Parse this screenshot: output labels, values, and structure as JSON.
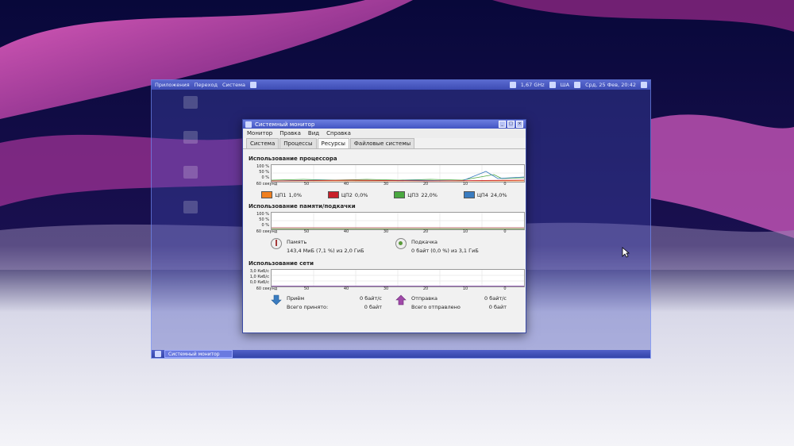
{
  "colors": {
    "panel": "#4355c2",
    "accent": "#ff7a1a"
  },
  "top_panel": {
    "menus": [
      "Приложения",
      "Переход",
      "Система"
    ],
    "cpu_freq": "1,67 GHz",
    "keyboard": "ША",
    "clock": "Срд, 25 Фев, 20:42"
  },
  "window": {
    "title": "Системный монитор",
    "menu": [
      "Монитор",
      "Правка",
      "Вид",
      "Справка"
    ],
    "tabs": [
      "Система",
      "Процессы",
      "Ресурсы",
      "Файловые системы"
    ],
    "active_tab": 2,
    "cpu": {
      "title": "Использование процессора",
      "y_labels": [
        "100 %",
        "50 %",
        "0 %"
      ],
      "x_labels": [
        "60 секунд",
        "50",
        "40",
        "30",
        "20",
        "10",
        "0"
      ],
      "legend": [
        {
          "label": "ЦП1",
          "value": "1,0%",
          "color": "#f08020"
        },
        {
          "label": "ЦП2",
          "value": "0,0%",
          "color": "#c8202a"
        },
        {
          "label": "ЦП3",
          "value": "22,0%",
          "color": "#4aa840"
        },
        {
          "label": "ЦП4",
          "value": "24,0%",
          "color": "#3a7cc0"
        }
      ]
    },
    "memory": {
      "title": "Использование памяти/подкачки",
      "y_labels": [
        "100 %",
        "50 %",
        "0 %"
      ],
      "x_labels": [
        "60 секунд",
        "50",
        "40",
        "30",
        "20",
        "10",
        "0"
      ],
      "mem_label": "Память",
      "mem_value": "143,4 МиБ (7,1 %) из 2,0 ГиБ",
      "swap_label": "Подкачка",
      "swap_value": "0 байт (0,0 %) из 3,1 ГиБ"
    },
    "network": {
      "title": "Использование сети",
      "y_labels": [
        "3,0 КиБ/с",
        "1,0 КиБ/с",
        "0,0 КиБ/с"
      ],
      "x_labels": [
        "60 секунд",
        "50",
        "40",
        "30",
        "20",
        "10",
        "0"
      ],
      "recv_label": "Приём",
      "recv_rate": "0 байт/с",
      "recv_total_label": "Всего принято:",
      "recv_total": "0 байт",
      "send_label": "Отправка",
      "send_rate": "0 байт/с",
      "send_total_label": "Всего отправлено",
      "send_total": "0 байт"
    }
  },
  "bottom_panel": {
    "task": "Системный монитор"
  }
}
